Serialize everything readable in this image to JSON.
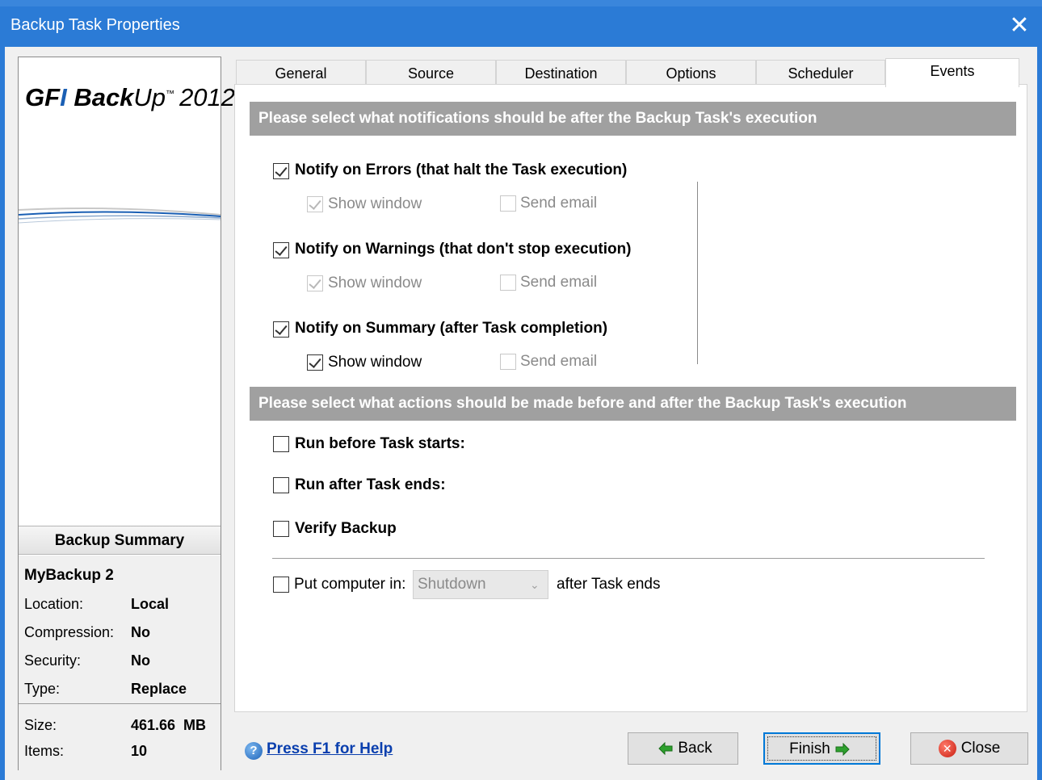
{
  "window": {
    "title": "Backup Task Properties",
    "close_glyph": "✕"
  },
  "logo": {
    "gfi": "GF",
    "gfi_i": "I",
    "backup_b": "Back",
    "backup_up": "Up",
    "trademark": "™",
    "year": "2012"
  },
  "tabs": [
    {
      "label": "General"
    },
    {
      "label": "Source"
    },
    {
      "label": "Destination"
    },
    {
      "label": "Options"
    },
    {
      "label": "Scheduler"
    },
    {
      "label": "Events",
      "active": true
    }
  ],
  "notifications": {
    "header": "Please select what notifications should be after the Backup Task's execution",
    "errors": {
      "label": "Notify on Errors  (that halt the Task execution)",
      "checked": true,
      "show_window": {
        "label": "Show window",
        "checked": true,
        "enabled": false
      },
      "send_email": {
        "label": "Send email",
        "checked": false,
        "enabled": false
      }
    },
    "warnings": {
      "label": "Notify on Warnings  (that don't stop execution)",
      "checked": true,
      "show_window": {
        "label": "Show window",
        "checked": true,
        "enabled": false
      },
      "send_email": {
        "label": "Send email",
        "checked": false,
        "enabled": false
      }
    },
    "summary": {
      "label": "Notify on Summary  (after Task completion)",
      "checked": true,
      "show_window": {
        "label": "Show window",
        "checked": true,
        "enabled": true
      },
      "send_email": {
        "label": "Send email",
        "checked": false,
        "enabled": false
      }
    }
  },
  "actions": {
    "header": "Please select what actions should be made before and after the Backup Task's execution",
    "run_before": {
      "label": "Run before Task starts:",
      "checked": false
    },
    "run_after": {
      "label": "Run after Task ends:",
      "checked": false
    },
    "verify": {
      "label": "Verify Backup",
      "checked": false
    },
    "put_computer": {
      "label": "Put computer in:",
      "checked": false,
      "selected": "Shutdown",
      "suffix": "after Task ends"
    }
  },
  "summary": {
    "header": "Backup Summary",
    "name": "MyBackup 2",
    "rows": [
      {
        "key": "Location:",
        "value": "Local"
      },
      {
        "key": "Compression:",
        "value": "No"
      },
      {
        "key": "Security:",
        "value": "No"
      },
      {
        "key": "Type:",
        "value": "Replace"
      }
    ],
    "rows2": [
      {
        "key": "Size:",
        "value": "461.66  MB"
      },
      {
        "key": "Items:",
        "value": "10"
      }
    ]
  },
  "footer": {
    "help_icon_glyph": "?",
    "help_text": "Press F1 for Help",
    "back_label": "Back",
    "finish_label": "Finish",
    "close_label": "Close",
    "close_icon_glyph": "✕",
    "arrow_color": "#2ea12e",
    "close_icon_color": "#d8281a"
  }
}
